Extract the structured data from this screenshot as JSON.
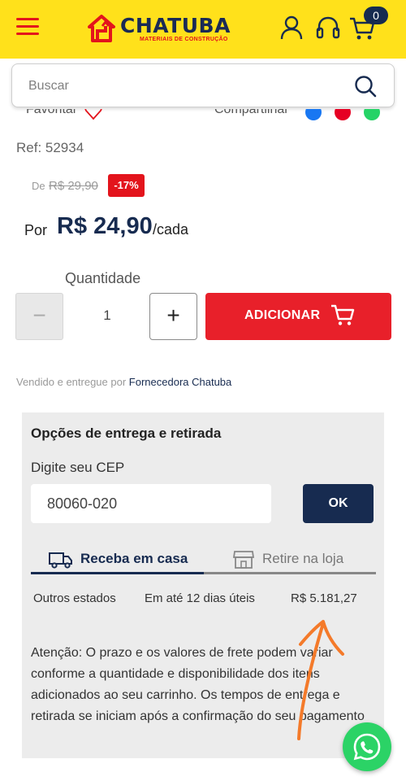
{
  "header": {
    "logo_text": "CHATUBA",
    "logo_subtitle": "MATERIAIS DE CONSTRUÇÃO",
    "cart_count": "0",
    "icons": [
      "menu-icon",
      "user-icon",
      "headset-icon",
      "cart-icon"
    ]
  },
  "search": {
    "placeholder": "Buscar"
  },
  "product": {
    "favorite_label": "Favoritar",
    "share_label": "Compartilhar",
    "ref": "Ref: 52934",
    "old_price_prefix": "De",
    "old_price": "R$ 29,90",
    "discount": "-17%",
    "price_prefix": "Por",
    "price": "R$ 24,90",
    "price_unit": "/cada",
    "quantity_label": "Quantidade",
    "quantity_value": "1",
    "minus_label": "−",
    "plus_label": "+",
    "add_button_label": "ADICIONAR",
    "seller_prefix": "Vendido e entregue por",
    "seller_name": "Fornecedora Chatuba"
  },
  "delivery": {
    "title": "Opções de entrega e retirada",
    "cep_label": "Digite seu CEP",
    "cep_value": "80060-020",
    "ok_label": "OK",
    "tabs": [
      {
        "label": "Receba em casa",
        "active": true
      },
      {
        "label": "Retire na loja",
        "active": false
      }
    ],
    "shipping_row": {
      "region": "Outros estados",
      "deadline": "Em até 12 dias úteis",
      "price": "R$ 5.181,27"
    },
    "notice": "Atenção: O prazo e os valores de frete podem variar conforme a quantidade e disponibilidade dos itens adicionados ao seu carrinho. Os tempos de entrega e retirada se iniciam após a confirmação do seu pagamento"
  },
  "colors": {
    "header_bg": "#ffe11b",
    "brand_red": "#e3141c",
    "brand_navy": "#172b50",
    "annotation_arrow": "#f47a2a",
    "whatsapp_green": "#2bd366"
  }
}
